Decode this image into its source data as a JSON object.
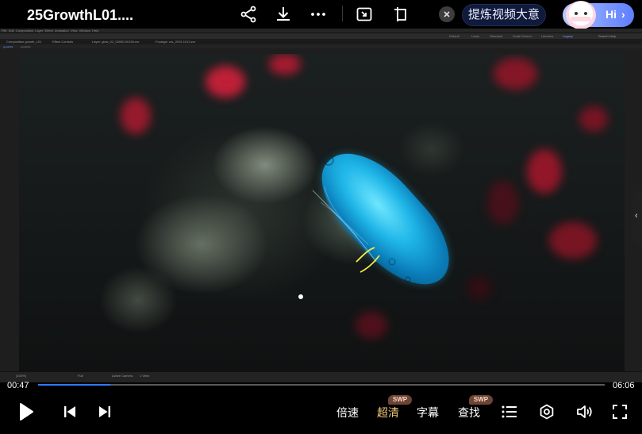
{
  "header": {
    "title": "25GrowthL01....",
    "ai_pill_label": "提炼视频大意",
    "hi_label": "Hi",
    "hi_chevron": "›"
  },
  "editor": {
    "menu_items": [
      "File",
      "Edit",
      "Composition",
      "Layer",
      "Effect",
      "Animation",
      "View",
      "Window",
      "Help"
    ],
    "workspaces": [
      "Default",
      "Learn",
      "Standard",
      "Small Screen",
      "Libraries",
      "Legacy"
    ],
    "search_label": "Search Help",
    "tabs": [
      "Composition growth_L01",
      "Effect Controls",
      "Layer: glow_02_00000-00150.exr",
      "Footage: crs_2019-1013.exr"
    ],
    "sub_tabs": [
      "growth01",
      "growth02"
    ],
    "bottom_bar": [
      "(100%)",
      "Full",
      "Active Camera",
      "1 View"
    ]
  },
  "player": {
    "current_time": "00:47",
    "duration": "06:06",
    "progress": 0.128,
    "controls": {
      "speed_label": "倍速",
      "quality_label": "超清",
      "quality_badge": "SWP",
      "subtitle_label": "字幕",
      "search_label": "查找",
      "search_badge": "SWP"
    },
    "accent_color": "#2f7bff",
    "highlight_color": "#f2c879"
  }
}
